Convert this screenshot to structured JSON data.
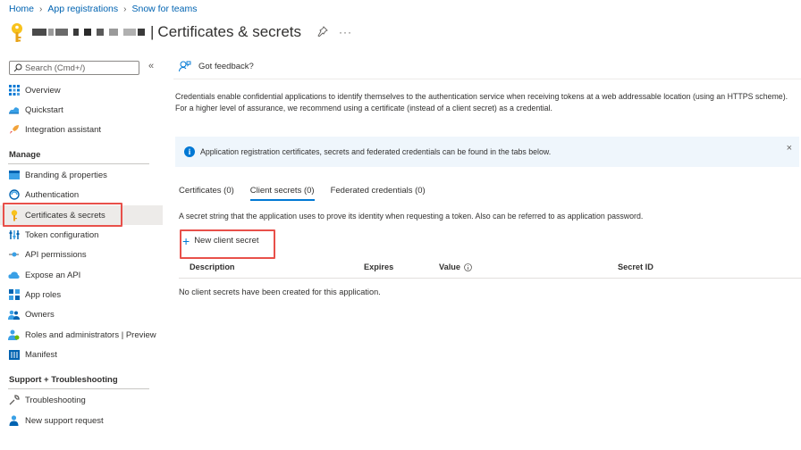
{
  "breadcrumb": {
    "items": [
      "Home",
      "App registrations",
      "Snow for teams"
    ]
  },
  "header": {
    "bar": "|",
    "title": "Certificates & secrets",
    "pin_icon": "pin-icon",
    "more": "···"
  },
  "sidebar": {
    "search_placeholder": "Search (Cmd+/)",
    "collapse": "«",
    "top_items": [
      {
        "label": "Overview",
        "icon": "overview-icon"
      },
      {
        "label": "Quickstart",
        "icon": "quickstart-icon"
      },
      {
        "label": "Integration assistant",
        "icon": "rocket-icon"
      }
    ],
    "manage_heading": "Manage",
    "manage_items": [
      {
        "label": "Branding & properties",
        "icon": "branding-icon"
      },
      {
        "label": "Authentication",
        "icon": "authentication-icon"
      },
      {
        "label": "Certificates & secrets",
        "icon": "key-icon",
        "active": true
      },
      {
        "label": "Token configuration",
        "icon": "token-icon"
      },
      {
        "label": "API permissions",
        "icon": "api-permissions-icon"
      },
      {
        "label": "Expose an API",
        "icon": "cloud-icon"
      },
      {
        "label": "App roles",
        "icon": "app-roles-icon"
      },
      {
        "label": "Owners",
        "icon": "owners-icon"
      },
      {
        "label": "Roles and administrators | Preview",
        "icon": "roles-admin-icon"
      },
      {
        "label": "Manifest",
        "icon": "manifest-icon"
      }
    ],
    "support_heading": "Support + Troubleshooting",
    "support_items": [
      {
        "label": "Troubleshooting",
        "icon": "wrench-icon"
      },
      {
        "label": "New support request",
        "icon": "support-person-icon"
      }
    ]
  },
  "main": {
    "feedback": "Got feedback?",
    "description": "Credentials enable confidential applications to identify themselves to the authentication service when receiving tokens at a web addressable location (using an HTTPS scheme). For a higher level of assurance, we recommend using a certificate (instead of a client secret) as a credential.",
    "info_banner": "Application registration certificates, secrets and federated credentials can be found in the tabs below.",
    "info_close": "×",
    "tabs": [
      {
        "label": "Certificates (0)"
      },
      {
        "label": "Client secrets (0)",
        "active": true
      },
      {
        "label": "Federated credentials (0)"
      }
    ],
    "secret_description": "A secret string that the application uses to prove its identity when requesting a token. Also can be referred to as application password.",
    "new_secret_label": "New client secret",
    "columns": [
      "Description",
      "Expires",
      "Value",
      "Secret ID"
    ],
    "empty_message": "No client secrets have been created for this application."
  },
  "colors": {
    "accent": "#0078d4",
    "link": "#0063b1",
    "highlight_box": "#e8504a",
    "info_bg": "#eff6fc"
  }
}
